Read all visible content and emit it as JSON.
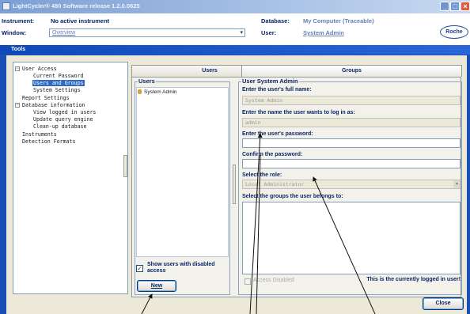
{
  "app": {
    "title": "LightCycler® 480 Software release 1.2.0.0625"
  },
  "header": {
    "instrument_label": "Instrument:",
    "instrument_value": "No active instrument",
    "database_label": "Database:",
    "database_value": "My Computer (Traceable)",
    "window_label": "Window:",
    "window_value": "Overview",
    "user_label": "User:",
    "user_value": "System Admin",
    "logo_text": "Roche"
  },
  "tools": {
    "title": "Tools",
    "tree": [
      {
        "label": "User Access",
        "toggle": "−"
      },
      {
        "label": "Current Password"
      },
      {
        "label": "Users and Groups",
        "selected": true
      },
      {
        "label": "System Settings"
      },
      {
        "label": "Report Settings"
      },
      {
        "label": "Database information",
        "toggle": "−"
      },
      {
        "label": "View logged in users"
      },
      {
        "label": "Update query engine"
      },
      {
        "label": "Clean-up database"
      },
      {
        "label": "Instruments"
      },
      {
        "label": "Detection Formats"
      }
    ],
    "tabs": {
      "users": "Users",
      "groups": "Groups"
    },
    "users_panel": {
      "legend": "Users",
      "items": [
        "System Admin"
      ],
      "show_disabled_label": "Show users with disabled access",
      "show_disabled_checked": true,
      "show_disabled_check_glyph": "✓",
      "new_button": "New"
    },
    "details": {
      "legend": "User System Admin",
      "full_name_label": "Enter the user's full name:",
      "full_name_value": "System Admin",
      "login_label": "Enter the name the user wants to log in as:",
      "login_value": "admin",
      "password_label": "Enter the user's password:",
      "password_value": "",
      "confirm_label": "Confirm the password:",
      "confirm_value": "",
      "role_label": "Select the role:",
      "role_value": "Local Administrator",
      "groups_label": "Select the groups the user belongs to:",
      "access_disabled_label": "Access Disabled",
      "current_user_note": "This is the currently logged in user!"
    },
    "close_button": "Close"
  },
  "colors": {
    "title_bar": "#7d9fd3",
    "tools_frame": "#1a4fb8",
    "selection": "#316ac5",
    "body": "#ece9d8"
  }
}
